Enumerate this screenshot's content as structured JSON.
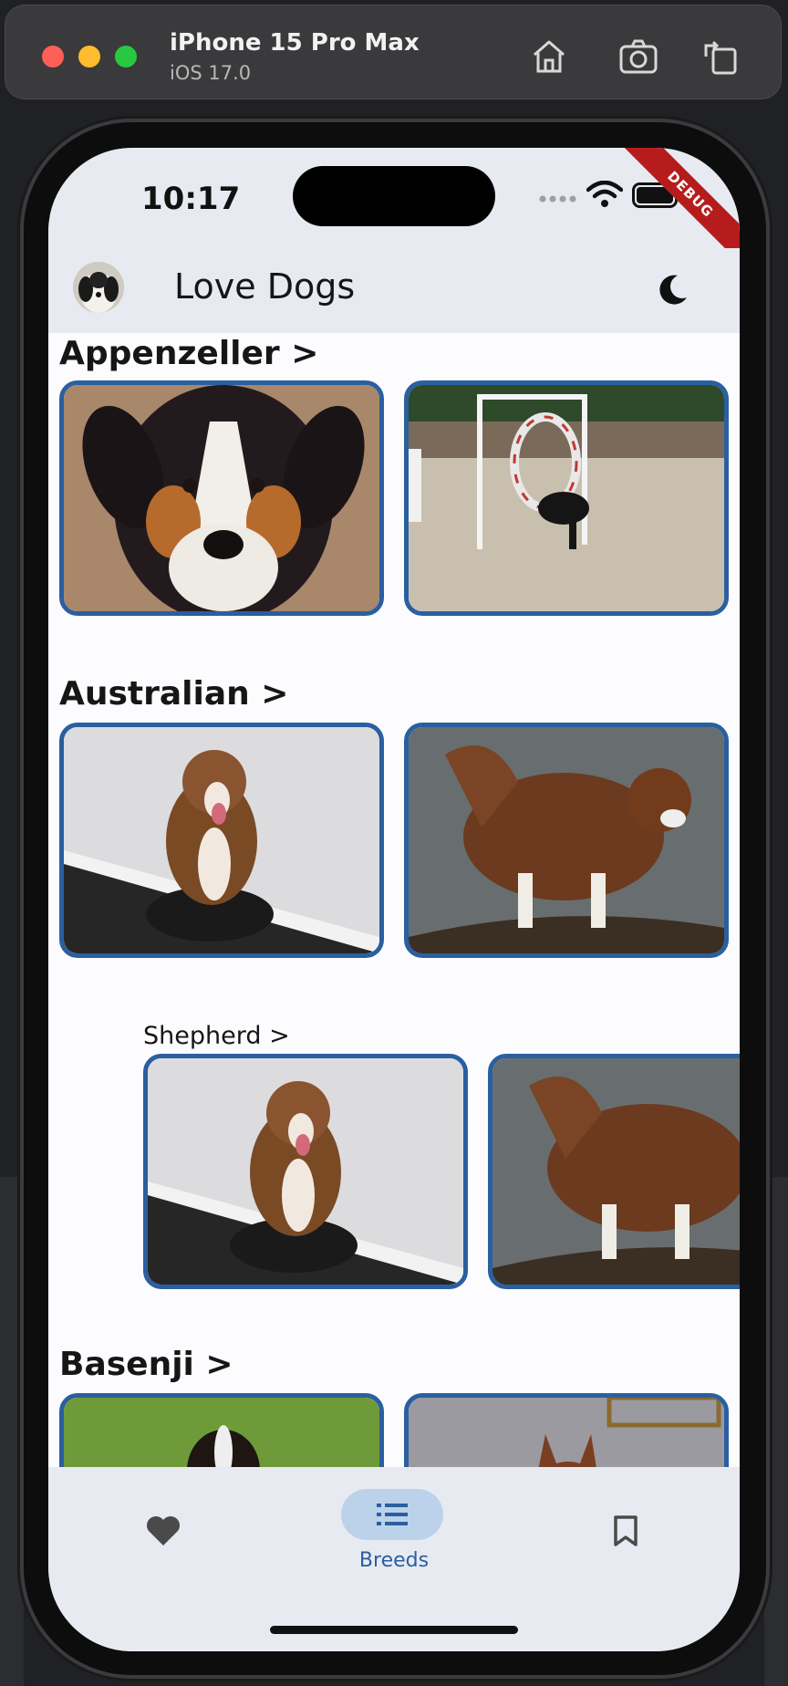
{
  "simulator": {
    "device": "iPhone 15 Pro Max",
    "os": "iOS 17.0",
    "buttons": [
      "home-icon",
      "screenshot-icon",
      "rotate-icon"
    ]
  },
  "status_bar": {
    "time": "10:17",
    "debug_label": "DEBUG"
  },
  "app_bar": {
    "title": "Love Dogs",
    "theme_icon": "moon-icon"
  },
  "breeds": [
    {
      "title": "Appenzeller >",
      "images": [
        "appenzeller-portrait",
        "appenzeller-agility"
      ]
    },
    {
      "title": "Australian >",
      "images": [
        "australian-sitting",
        "australian-tree"
      ],
      "sub_breeds": [
        {
          "title": "Shepherd >",
          "images": [
            "shepherd-sitting",
            "shepherd-tree"
          ]
        }
      ]
    },
    {
      "title": "Basenji >",
      "images": [
        "basenji-grass",
        "basenji-indoor"
      ]
    }
  ],
  "bottom_nav": {
    "items": [
      {
        "icon": "heart-icon",
        "label": ""
      },
      {
        "icon": "list-icon",
        "label": "Breeds",
        "selected": true
      },
      {
        "icon": "bookmark-icon",
        "label": ""
      }
    ]
  },
  "colors": {
    "accent": "#2a5fa0",
    "bar_bg": "#e7ebf1",
    "pill": "#bcd2ea"
  }
}
